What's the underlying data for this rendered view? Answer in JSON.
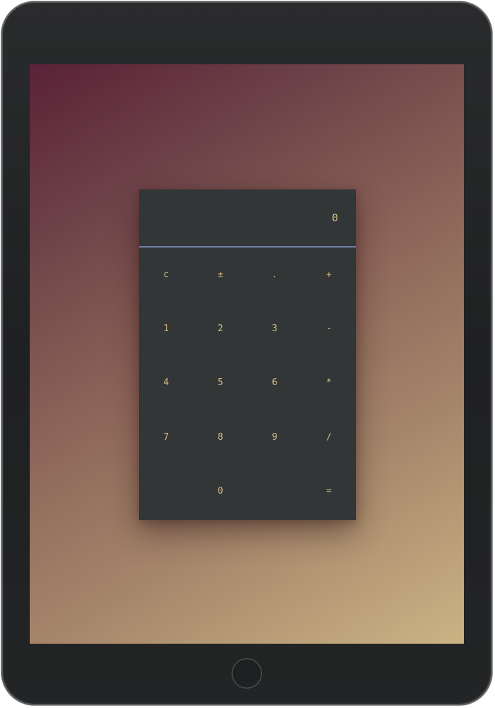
{
  "calculator": {
    "display": "0",
    "keys": [
      {
        "label": "c",
        "name": "clear-button"
      },
      {
        "label": "±",
        "name": "sign-toggle-button"
      },
      {
        "label": ".",
        "name": "decimal-button"
      },
      {
        "label": "+",
        "name": "add-button"
      },
      {
        "label": "1",
        "name": "digit-1-button"
      },
      {
        "label": "2",
        "name": "digit-2-button"
      },
      {
        "label": "3",
        "name": "digit-3-button"
      },
      {
        "label": "-",
        "name": "subtract-button"
      },
      {
        "label": "4",
        "name": "digit-4-button"
      },
      {
        "label": "5",
        "name": "digit-5-button"
      },
      {
        "label": "6",
        "name": "digit-6-button"
      },
      {
        "label": "*",
        "name": "multiply-button"
      },
      {
        "label": "7",
        "name": "digit-7-button"
      },
      {
        "label": "8",
        "name": "digit-8-button"
      },
      {
        "label": "9",
        "name": "digit-9-button"
      },
      {
        "label": "/",
        "name": "divide-button"
      },
      {
        "label": "",
        "name": "empty-key"
      },
      {
        "label": "0",
        "name": "digit-0-button"
      },
      {
        "label": "",
        "name": "empty-key"
      },
      {
        "label": "=",
        "name": "equals-button"
      }
    ]
  },
  "colors": {
    "calculator_background": "#323637",
    "key_text": "#d8bd84",
    "display_divider": "#6e84a6"
  }
}
